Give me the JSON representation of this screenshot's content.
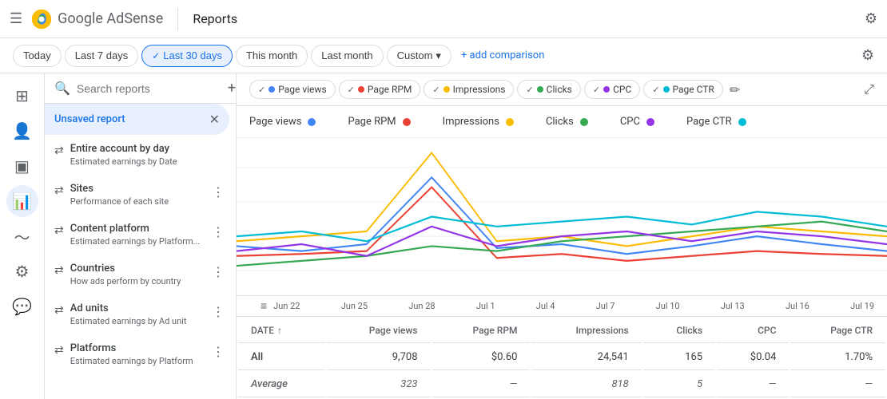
{
  "topbar": {
    "menu_label": "☰",
    "logo_text": "Google AdSense",
    "divider": "",
    "title": "Reports",
    "gear_label": "⚙"
  },
  "filterbar": {
    "today": "Today",
    "last7": "Last 7 days",
    "last30": "Last 30 days",
    "this_month": "This month",
    "last_month": "Last month",
    "custom": "Custom",
    "add_comparison": "+ add comparison"
  },
  "sidebar": {
    "search_placeholder": "Search reports",
    "add_icon": "+",
    "active_item": "Unsaved report",
    "close_icon": "✕",
    "items": [
      {
        "title": "Entire account by day",
        "subtitle": "Estimated earnings by Date"
      },
      {
        "title": "Sites",
        "subtitle": "Performance of each site"
      },
      {
        "title": "Content platform",
        "subtitle": "Estimated earnings by Platform..."
      },
      {
        "title": "Countries",
        "subtitle": "How ads perform by country"
      },
      {
        "title": "Ad units",
        "subtitle": "Estimated earnings by Ad unit"
      },
      {
        "title": "Platforms",
        "subtitle": "Estimated earnings by Platform"
      }
    ]
  },
  "metrics": {
    "chips": [
      {
        "label": "Page views",
        "color": "#4285f4"
      },
      {
        "label": "Page RPM",
        "color": "#ea4335"
      },
      {
        "label": "Impressions",
        "color": "#fbbc04"
      },
      {
        "label": "Clicks",
        "color": "#34a853"
      },
      {
        "label": "CPC",
        "color": "#9334e6"
      },
      {
        "label": "Page CTR",
        "color": "#00bcd4"
      }
    ]
  },
  "legend": [
    {
      "label": "Page views",
      "color": "#4285f4"
    },
    {
      "label": "Page RPM",
      "color": "#ea4335"
    },
    {
      "label": "Impressions",
      "color": "#fbbc04"
    },
    {
      "label": "Clicks",
      "color": "#34a853"
    },
    {
      "label": "CPC",
      "color": "#9334e6"
    },
    {
      "label": "Page CTR",
      "color": "#00bcd4"
    }
  ],
  "xaxis": {
    "labels": [
      "Jun 22",
      "Jun 25",
      "Jun 28",
      "Jul 1",
      "Jul 4",
      "Jul 7",
      "Jul 10",
      "Jul 13",
      "Jul 16",
      "Jul 19"
    ]
  },
  "table": {
    "headers": [
      "DATE",
      "Page views",
      "Page RPM",
      "Impressions",
      "Clicks",
      "CPC",
      "Page CTR"
    ],
    "rows": [
      {
        "date": "All",
        "page_views": "9,708",
        "page_rpm": "$0.60",
        "impressions": "24,541",
        "clicks": "165",
        "cpc": "$0.04",
        "page_ctr": "1.70%"
      },
      {
        "date": "Average",
        "page_views": "323",
        "page_rpm": "—",
        "impressions": "818",
        "clicks": "5",
        "cpc": "—",
        "page_ctr": "—"
      }
    ]
  },
  "left_nav": {
    "icons": [
      "⊞",
      "👤",
      "▣",
      "📊",
      "〜",
      "⚙",
      "💬"
    ]
  }
}
